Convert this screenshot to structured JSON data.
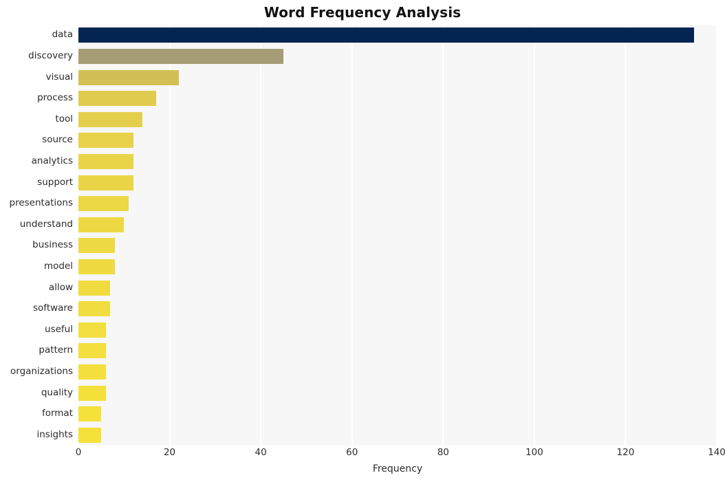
{
  "chart_data": {
    "type": "bar",
    "orientation": "horizontal",
    "title": "Word Frequency Analysis",
    "xlabel": "Frequency",
    "ylabel": "",
    "categories": [
      "data",
      "discovery",
      "visual",
      "process",
      "tool",
      "source",
      "analytics",
      "support",
      "presentations",
      "understand",
      "business",
      "model",
      "allow",
      "software",
      "useful",
      "pattern",
      "organizations",
      "quality",
      "format",
      "insights"
    ],
    "values": [
      135,
      45,
      22,
      17,
      14,
      12,
      12,
      12,
      11,
      10,
      8,
      8,
      7,
      7,
      6,
      6,
      6,
      6,
      5,
      5
    ],
    "bar_colors": [
      "#042552",
      "#a69d76",
      "#d3c055",
      "#e0cb4f",
      "#e4cf4c",
      "#e7d24a",
      "#e9d448",
      "#ead546",
      "#ecd745",
      "#edd844",
      "#eeda42",
      "#efdb41",
      "#f0dc40",
      "#f1dd3f",
      "#f2de3e",
      "#f3df3d",
      "#f3e03c",
      "#f4e03b",
      "#f5e13a",
      "#f5e139"
    ],
    "xlim": [
      0,
      140
    ],
    "xticks": [
      0,
      20,
      40,
      60,
      80,
      100,
      120,
      140
    ],
    "xtick_labels": [
      "0",
      "20",
      "40",
      "60",
      "80",
      "100",
      "120",
      "140"
    ],
    "grid": true,
    "grid_axis": "x",
    "grid_color": "#ffffff",
    "plot_background": "#f7f7f7",
    "figure_background": "#ffffff",
    "legend": null
  }
}
